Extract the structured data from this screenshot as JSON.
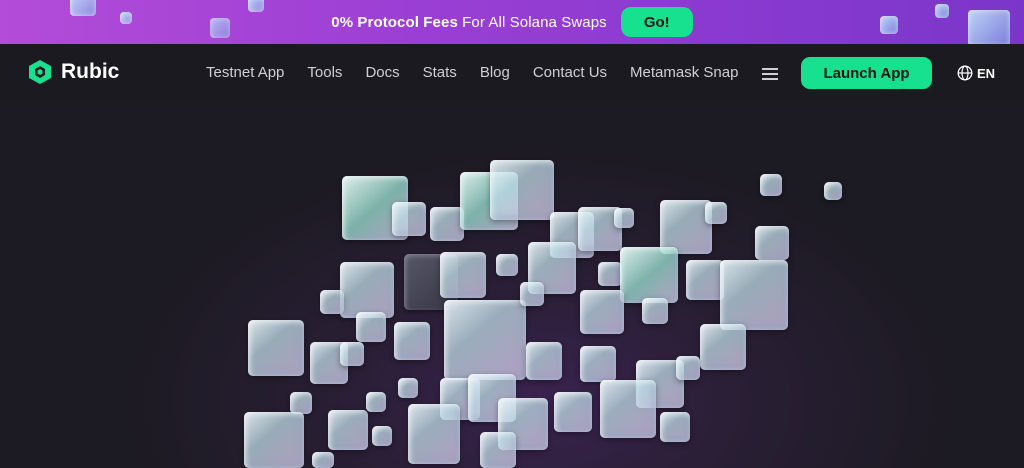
{
  "promo": {
    "highlight": "0% Protocol Fees",
    "text": "For All Solana Swaps",
    "button": "Go!"
  },
  "nav": {
    "brand": "Rubic",
    "links": [
      "Testnet App",
      "Tools",
      "Docs",
      "Stats",
      "Blog",
      "Contact Us",
      "Metamask Snap"
    ],
    "launch": "Launch App",
    "lang": "EN"
  },
  "colors": {
    "accent": "#17e08f",
    "promo_bg": "#9b3fd4",
    "page_bg": "#1c1a22"
  },
  "icons": [
    "rubic-logo-icon",
    "menu-icon",
    "globe-icon"
  ]
}
